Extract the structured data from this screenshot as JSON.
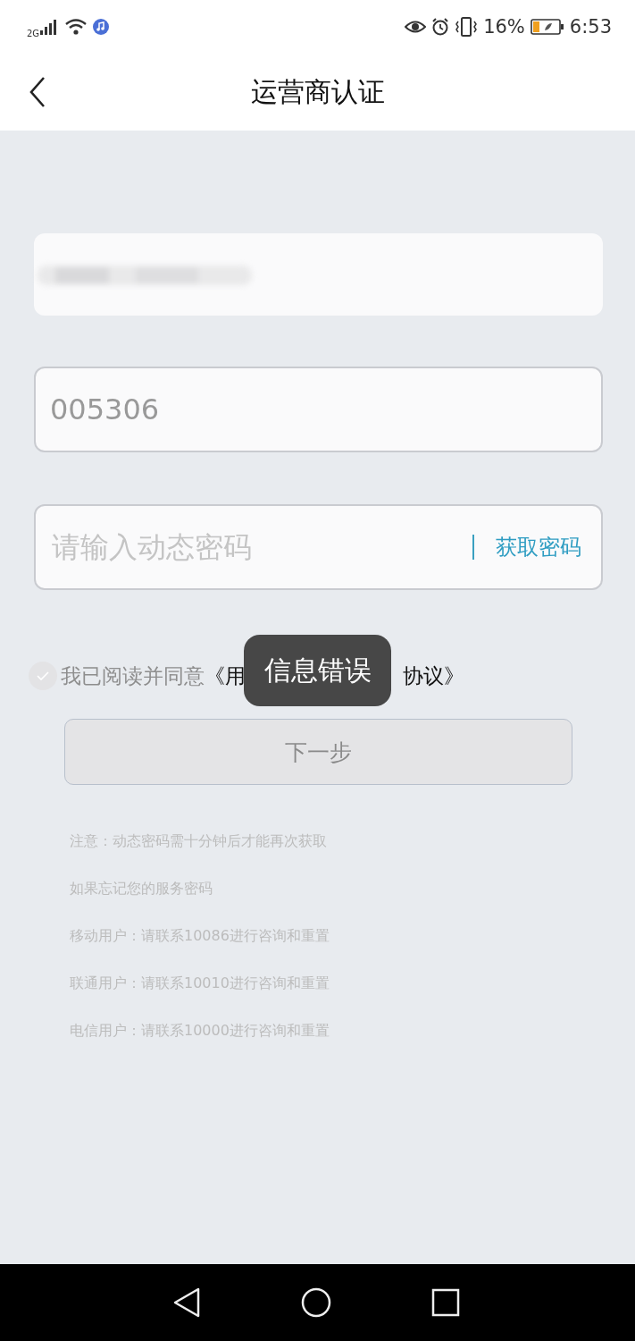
{
  "status_bar": {
    "network": "2G",
    "battery": "16%",
    "time": "6:53"
  },
  "header": {
    "title": "运营商认证"
  },
  "fields": [
    {
      "kind": "blurred"
    },
    {
      "kind": "value",
      "value": "005306"
    },
    {
      "kind": "password",
      "placeholder": "请输入动态密码",
      "action": "获取密码"
    }
  ],
  "agreement": {
    "checked": false,
    "text": "我已阅读并同意",
    "link_parts": [
      "《用",
      "协议》"
    ]
  },
  "next_button": {
    "label": "下一步",
    "disabled": true
  },
  "notes": [
    "注意：动态密码需十分钟后才能再次获取",
    "如果忘记您的服务密码",
    "移动用户：请联系10086进行咨询和重置",
    "联通用户：请联系10010进行咨询和重置",
    "电信用户：请联系10000进行咨询和重置"
  ],
  "toast": {
    "text": "信息错误"
  }
}
